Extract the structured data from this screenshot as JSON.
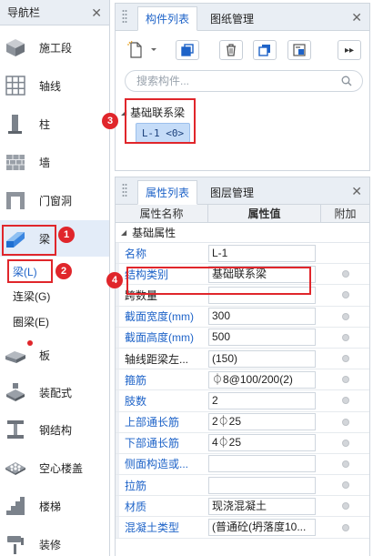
{
  "nav": {
    "title": "导航栏",
    "items": [
      {
        "label": "施工段",
        "icon": "construction-section-icon"
      },
      {
        "label": "轴线",
        "icon": "axis-grid-icon"
      },
      {
        "label": "柱",
        "icon": "column-icon"
      },
      {
        "label": "墙",
        "icon": "wall-icon"
      },
      {
        "label": "门窗洞",
        "icon": "door-window-icon"
      },
      {
        "label": "梁",
        "icon": "beam-icon"
      },
      {
        "label": "板",
        "icon": "slab-icon"
      },
      {
        "label": "装配式",
        "icon": "prefab-icon"
      },
      {
        "label": "钢结构",
        "icon": "steel-structure-icon"
      },
      {
        "label": "空心楼盖",
        "icon": "hollow-floor-icon"
      },
      {
        "label": "楼梯",
        "icon": "stair-icon"
      },
      {
        "label": "装修",
        "icon": "decoration-icon"
      }
    ],
    "sub_items": [
      "梁(L)",
      "连梁(G)",
      "圈梁(E)"
    ]
  },
  "component_pane": {
    "tabs": [
      "构件列表",
      "图纸管理"
    ],
    "search_placeholder": "搜索构件...",
    "tree_root": "基础联系梁",
    "tree_leaf": "L-1 <0>"
  },
  "property_pane": {
    "tabs": [
      "属性列表",
      "图层管理"
    ],
    "headers": {
      "name": "属性名称",
      "value": "属性值",
      "attach": "附加"
    },
    "group": "基础属性",
    "rows": [
      {
        "name": "名称",
        "value": "L-1",
        "blue": true,
        "dot": false
      },
      {
        "name": "结构类别",
        "value": "基础联系梁",
        "blue": true,
        "dot": true
      },
      {
        "name": "跨数量",
        "value": "",
        "blue": false,
        "dot": true
      },
      {
        "name": "截面宽度(mm)",
        "value": "300",
        "blue": true,
        "dot": true
      },
      {
        "name": "截面高度(mm)",
        "value": "500",
        "blue": true,
        "dot": true
      },
      {
        "name": "轴线距梁左...",
        "value": "(150)",
        "blue": false,
        "dot": true
      },
      {
        "name": "箍筋",
        "value": "⏀8@100/200(2)",
        "blue": true,
        "dot": true
      },
      {
        "name": "肢数",
        "value": "2",
        "blue": true,
        "dot": true
      },
      {
        "name": "上部通长筋",
        "value": "2⏀25",
        "blue": true,
        "dot": true
      },
      {
        "name": "下部通长筋",
        "value": "4⏀25",
        "blue": true,
        "dot": true
      },
      {
        "name": "侧面构造或...",
        "value": "",
        "blue": true,
        "dot": true
      },
      {
        "name": "拉筋",
        "value": "",
        "blue": true,
        "dot": true
      },
      {
        "name": "材质",
        "value": "现浇混凝土",
        "blue": true,
        "dot": true
      },
      {
        "name": "混凝土类型",
        "value": "(普通砼(坍落度10...",
        "blue": true,
        "dot": true
      }
    ]
  },
  "callouts": [
    "1",
    "2",
    "3",
    "4"
  ],
  "colors": {
    "accent": "#1e63c8",
    "callout": "#e0262b",
    "selection": "#c5dcf8"
  }
}
